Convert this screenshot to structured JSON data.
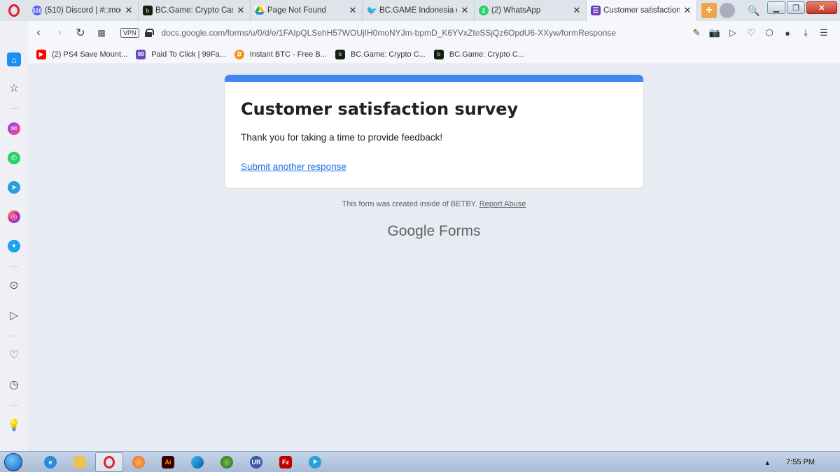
{
  "tabs": [
    {
      "title": "(510) Discord | #□moc",
      "icon": "discord-icon",
      "color": "#5865f2",
      "badge": "510",
      "active": false
    },
    {
      "title": "BC.Game: Crypto Casi",
      "icon": "bcgame-icon",
      "color": "#1a1a1a",
      "active": false
    },
    {
      "title": "Page Not Found",
      "icon": "google-drive-icon",
      "color": "#1fa463",
      "active": false
    },
    {
      "title": "BC.GAME Indonesia o",
      "icon": "twitter-icon",
      "color": "#1da1f2",
      "active": false
    },
    {
      "title": "(2) WhatsApp",
      "icon": "whatsapp-icon",
      "color": "#25d366",
      "badge": "2",
      "active": false
    },
    {
      "title": "Customer satisfaction",
      "icon": "google-forms-icon",
      "color": "#673ab7",
      "active": true
    }
  ],
  "address": {
    "vpn_label": "VPN",
    "url": "docs.google.com/forms/u/0/d/e/1FAIpQLSehH57WOUjIH0moNYJm-bpmD_K6YVxZteSSjQz6OpdU6-XXyw/formResponse"
  },
  "bookmarks": [
    {
      "label": "(2) PS4 Save Mount...",
      "icon": "youtube-icon",
      "color": "#ff0000"
    },
    {
      "label": "Paid To Click | 99Fa...",
      "icon": "99faucet-icon",
      "color": "#6a4bbf"
    },
    {
      "label": "Instant BTC - Free B...",
      "icon": "bitcoin-icon",
      "color": "#f7931a"
    },
    {
      "label": "BC.Game: Crypto C...",
      "icon": "bcgame-icon",
      "color": "#1a1a1a"
    },
    {
      "label": "BC.Game: Crypto C...",
      "icon": "bcgame-icon",
      "color": "#1a1a1a"
    }
  ],
  "form": {
    "title": "Customer satisfaction survey",
    "message": "Thank you for taking a time to provide feedback!",
    "link_label": "Submit another response",
    "accent_color": "#4285f4"
  },
  "footer": {
    "note": "This form was created inside of BETBY.",
    "report_label": "Report Abuse",
    "brand_google": "Google",
    "brand_forms": "Forms"
  },
  "taskbar": {
    "clock": "7:55 PM",
    "tray_arrow": "▴"
  }
}
